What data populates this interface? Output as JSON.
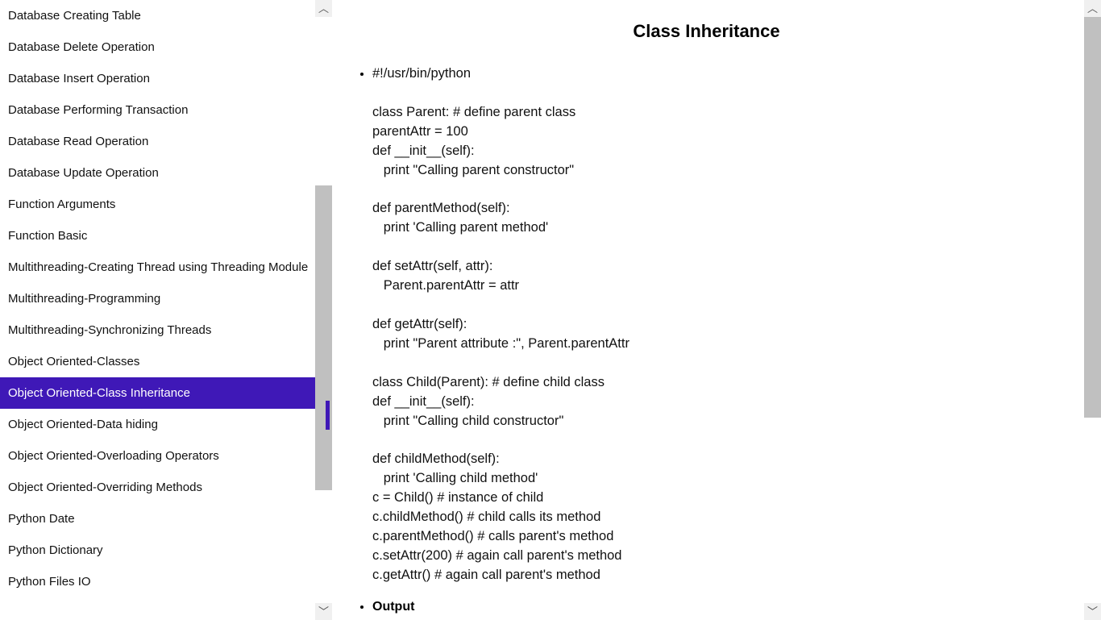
{
  "sidebar": {
    "items": [
      {
        "label": "Database Creating Table"
      },
      {
        "label": "Database Delete Operation"
      },
      {
        "label": "Database Insert Operation"
      },
      {
        "label": "Database Performing Transaction"
      },
      {
        "label": "Database Read Operation"
      },
      {
        "label": "Database Update Operation"
      },
      {
        "label": "Function Arguments"
      },
      {
        "label": "Function Basic"
      },
      {
        "label": "Multithreading-Creating Thread using Threading Module"
      },
      {
        "label": "Multithreading-Programming"
      },
      {
        "label": "Multithreading-Synchronizing Threads"
      },
      {
        "label": "Object Oriented-Classes"
      },
      {
        "label": "Object Oriented-Class Inheritance"
      },
      {
        "label": "Object Oriented-Data hiding"
      },
      {
        "label": "Object Oriented-Overloading Operators"
      },
      {
        "label": "Object Oriented-Overriding Methods"
      },
      {
        "label": "Python Date"
      },
      {
        "label": "Python Dictionary"
      },
      {
        "label": "Python Files IO"
      }
    ],
    "selected_index": 12
  },
  "content": {
    "title": "Class Inheritance",
    "code": "#!/usr/bin/python\n\nclass Parent: # define parent class\nparentAttr = 100\ndef __init__(self):\n   print \"Calling parent constructor\"\n\ndef parentMethod(self):\n   print 'Calling parent method'\n\ndef setAttr(self, attr):\n   Parent.parentAttr = attr\n\ndef getAttr(self):\n   print \"Parent attribute :\", Parent.parentAttr\n\nclass Child(Parent): # define child class\ndef __init__(self):\n   print \"Calling child constructor\"\n\ndef childMethod(self):\n   print 'Calling child method'\nc = Child() # instance of child\nc.childMethod() # child calls its method\nc.parentMethod() # calls parent's method\nc.setAttr(200) # again call parent's method\nc.getAttr() # again call parent's method",
    "output_label": "Output"
  }
}
